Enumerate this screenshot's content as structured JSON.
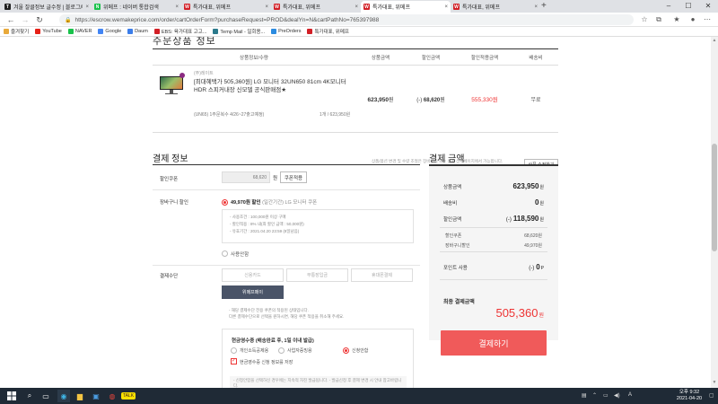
{
  "browser": {
    "tabs": [
      {
        "title": "겨울 잘클정보 글수정 | 블로그/마",
        "color": "#222",
        "glyph": "T",
        "active": false
      },
      {
        "title": "위메프 : 네이버 통합검색",
        "color": "#19c24b",
        "glyph": "N",
        "active": false
      },
      {
        "title": "특가대표, 위메프",
        "color": "#d21f26",
        "glyph": "W",
        "active": false
      },
      {
        "title": "특가대표, 위메프",
        "color": "#d21f26",
        "glyph": "W",
        "active": false
      },
      {
        "title": "특가대표, 위메프",
        "color": "#d21f26",
        "glyph": "W",
        "active": true
      },
      {
        "title": "특가대표, 위메프",
        "color": "#d21f26",
        "glyph": "W",
        "active": false
      }
    ],
    "new_tab": "+",
    "url": "https://escrow.wemakeprice.com/order/cartOrderForm?purchaseRequest=PROD&dealYn=N&cartPathNo=765397988",
    "bookmarks": [
      {
        "label": "즐겨찾기",
        "color": "#e8a93a"
      },
      {
        "label": "YouTube",
        "color": "#e62117"
      },
      {
        "label": "NAVER",
        "color": "#19c24b"
      },
      {
        "label": "Google",
        "color": "#4285f4"
      },
      {
        "label": "Daum",
        "color": "#3b7de9"
      },
      {
        "label": "EBS: 육가대표 고고...",
        "color": "#d21f26"
      },
      {
        "label": "Temp Mail - 일회용...",
        "color": "#2b7a8c"
      },
      {
        "label": "PreOrders",
        "color": "#2b8be0"
      },
      {
        "label": "특가대표, 위메프",
        "color": "#d21f26"
      }
    ]
  },
  "order": {
    "section_title": "주문상품 정보",
    "headers": [
      "상품정보/수량",
      "상품금액",
      "할인금액",
      "할인적용금액",
      "배송비"
    ],
    "product": {
      "seller": "(주)레이트",
      "name": "[최대혜택가 505,360원] LG 모니터 32UN650 81cm 4K모니터 HDR 스피커내장 신모델 공식판매점★",
      "option": "(UN65) 1주문복수 4/26~27출고예정)",
      "qty": "1개 / 623,950원",
      "price": "623,950",
      "discount": "68,620",
      "discount_prefix": "(-)",
      "final": "555,330",
      "shipping": "무료",
      "won": "원"
    },
    "notice": "상품/옵션 변경 및 수량 조절은 장바구니 또는 상품 상세페이지에서 가능합니다.",
    "modify_button": "상품 수정하기"
  },
  "payment_info": {
    "title": "결제 정보",
    "coupon_label": "할인쿠폰",
    "coupon_value": "68,620",
    "coupon_won": "원",
    "coupon_button": "쿠폰적용",
    "cart_discount_label": "장바구니 할인",
    "cart_discount_amount": "49,970원 할인",
    "cart_discount_detail": "(일간기간) LG 모니터 쿠폰",
    "conditions": [
      "- 사용조건 : 100,000원 이상 구매",
      "- 할인적용 : 8% 내(최 할인 금액 : 50,000원)",
      "- 유효기간 : 2021.04.20 23:59 (8일남음)"
    ],
    "no_use": "사용안함",
    "method_label": "결제수단",
    "methods": [
      "신용카드",
      "무통장입금",
      "휴대폰결제"
    ],
    "selected_method": "위메프페이",
    "notes": [
      "- 해당 결제수단 전용 쿠폰의 적용된 상태입니다.",
      "  다른 결제수단으로 선택을 원하시면, 해당 쿠폰 적용을 취소해 주세요."
    ],
    "cash_receipt_title": "현금영수증 (배송완료 후, 1일 이내 발급)",
    "cash_options": [
      "개인소득공제용",
      "사업자증빙용",
      "신청안함"
    ],
    "save_check": "현금영수증 신청 정보를 저장",
    "cash_notice": "- 신청안함을 선택하신 경우에는 지속적 자진 발급됩니다. - 발급신청 후 결제 변경 시 안내 참고바랍니다."
  },
  "summary": {
    "title": "결제 금액",
    "product_amount_label": "상품금액",
    "product_amount": "623,950",
    "shipping_label": "배송비",
    "shipping": "0",
    "discount_label": "할인금액",
    "discount_prefix": "(-)",
    "discount": "118,590",
    "sub_items": [
      {
        "label": "할인쿠폰",
        "value": "68,620원"
      },
      {
        "label": "장바구니할인",
        "value": "49,970원"
      }
    ],
    "point_label": "포인트 사용",
    "point_prefix": "(-)",
    "point": "0",
    "point_unit": "P",
    "final_label": "최종 결제금액",
    "final": "505,360",
    "won": "원",
    "pay_button": "결제하기"
  },
  "taskbar": {
    "time": "오후 9:32",
    "date": "2021-04-20",
    "ime": "A"
  }
}
